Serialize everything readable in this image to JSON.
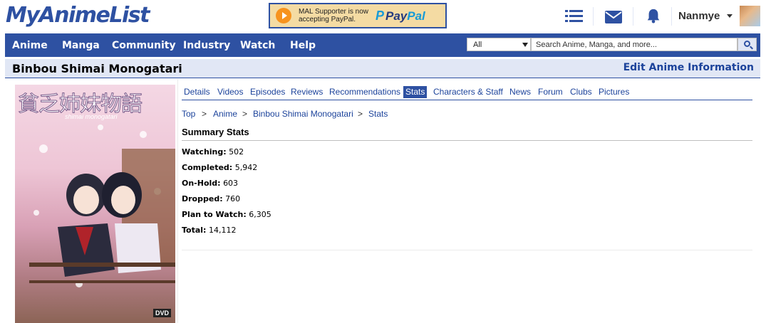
{
  "site": {
    "logo": "MyAnimeList"
  },
  "banner": {
    "text": "MAL Supporter is now accepting PayPal.",
    "pay": "Pay",
    "pal": "Pal"
  },
  "user": {
    "name": "Nanmye"
  },
  "nav": {
    "items": [
      "Anime",
      "Manga",
      "Community",
      "Industry",
      "Watch",
      "Help"
    ],
    "search": {
      "category": "All",
      "placeholder": "Search Anime, Manga, and more..."
    }
  },
  "page": {
    "title": "Binbou Shimai Monogatari",
    "edit_link": "Edit Anime Information"
  },
  "cover": {
    "title": "貧乏姉妹物語",
    "subtitle": "shimai monogatari",
    "badge": "DVD"
  },
  "tabs": [
    "Details",
    "Videos",
    "Episodes",
    "Reviews",
    "Recommendations",
    "Stats",
    "Characters & Staff",
    "News",
    "Forum",
    "Clubs",
    "Pictures"
  ],
  "active_tab": "Stats",
  "breadcrumb": {
    "items": [
      "Top",
      "Anime",
      "Binbou Shimai Monogatari",
      "Stats"
    ],
    "separator": ">"
  },
  "summary": {
    "title": "Summary Stats",
    "stats": [
      {
        "label": "Watching:",
        "value": "502"
      },
      {
        "label": "Completed:",
        "value": "5,942"
      },
      {
        "label": "On-Hold:",
        "value": "603"
      },
      {
        "label": "Dropped:",
        "value": "760"
      },
      {
        "label": "Plan to Watch:",
        "value": "6,305"
      },
      {
        "label": "Total:",
        "value": "14,112"
      }
    ]
  },
  "colors": {
    "brand": "#2e51a2",
    "link": "#1c439b",
    "title_bg": "#e1e7f5"
  }
}
